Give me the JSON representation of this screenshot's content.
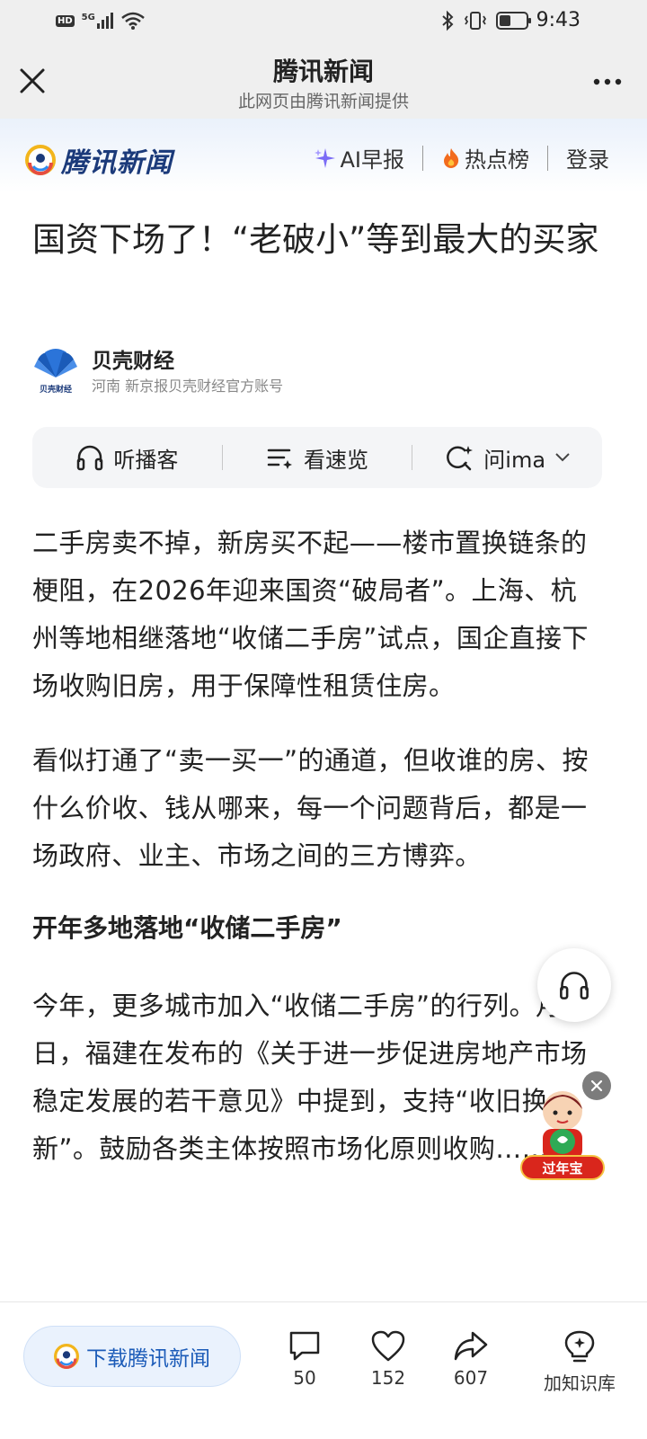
{
  "status_bar": {
    "time": "9:43",
    "left_icons": [
      "hd-icon",
      "5g-signal-icon",
      "wifi-icon"
    ],
    "hd_label": "HD",
    "network_label": "5G",
    "right_icons": [
      "bluetooth-icon",
      "vibrate-icon",
      "battery-icon"
    ]
  },
  "app_bar": {
    "title": "腾讯新闻",
    "subtitle": "此网页由腾讯新闻提供"
  },
  "site_header": {
    "logo_text": "腾讯新闻",
    "nav": [
      {
        "label": "AI早报",
        "icon": "sparkle-icon"
      },
      {
        "label": "热点榜",
        "icon": "flame-icon"
      },
      {
        "label": "登录"
      }
    ]
  },
  "article": {
    "title": "国资下场了！“老破小”等到最大的买家",
    "author": {
      "name": "贝壳财经",
      "meta": "河南  新京报贝壳财经官方账号",
      "logo_caption": "贝壳财经"
    },
    "tools": [
      {
        "label": "听播客",
        "icon": "headphones-icon"
      },
      {
        "label": "看速览",
        "icon": "list-sparkle-icon"
      },
      {
        "label": "问ima",
        "icon": "search-sparkle-icon"
      }
    ],
    "paragraphs": [
      "二手房卖不掉，新房买不起——楼市置换链条的梗阻，在2026年迎来国资“破局者”。上海、杭州等地相继落地“收储二手房”试点，国企直接下场收购旧房，用于保障性租赁住房。",
      "看似打通了“卖一买一”的通道，但收谁的房、按什么价收、钱从哪来，每一个问题背后，都是一场政府、业主、市场之间的三方博弈。"
    ],
    "subheading": "开年多地落地“收储二手房”",
    "paragraph3": "今年，更多城市加入“收储二手房”的行列。月4日，福建在发布的《关于进一步促进房地产市场稳定发展的若干意见》中提到，支持“收旧换新”。鼓励各类主体按照市场化原则收购……"
  },
  "floating": {
    "promo_label": "过年宝"
  },
  "bottom_bar": {
    "download_label": "下载腾讯新闻",
    "comments": "50",
    "likes": "152",
    "shares": "607",
    "knowledge_label": "加知识库"
  }
}
